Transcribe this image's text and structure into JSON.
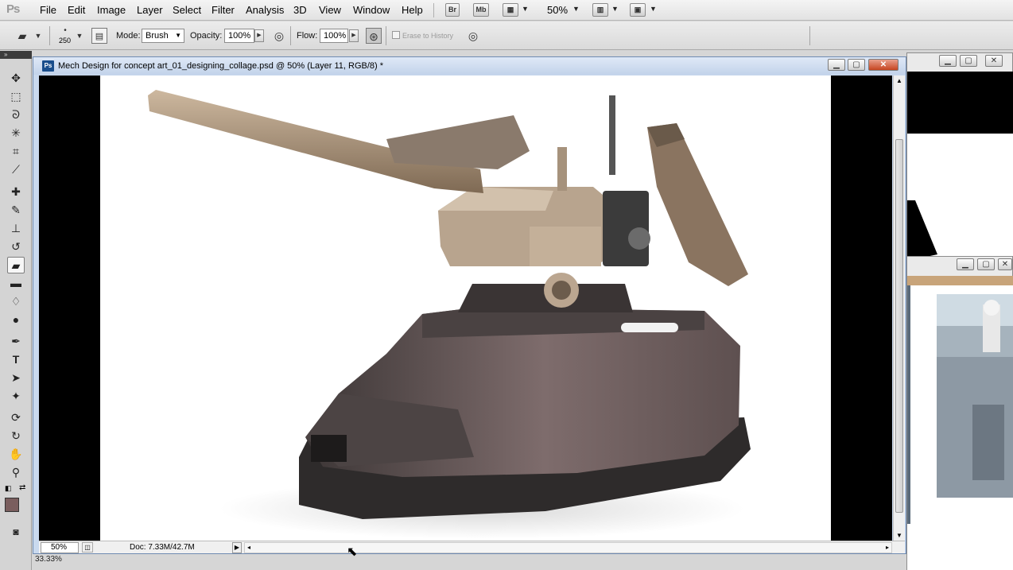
{
  "app": {
    "logo": "Ps"
  },
  "menu": [
    "File",
    "Edit",
    "Image",
    "Layer",
    "Select",
    "Filter",
    "Analysis",
    "3D",
    "View",
    "Window",
    "Help"
  ],
  "menubar_buttons": {
    "bridge": "Br",
    "minibridge": "Mb",
    "zoom": "50%"
  },
  "options": {
    "brush_size": "250",
    "mode_label": "Mode:",
    "mode_value": "Brush",
    "opacity_label": "Opacity:",
    "opacity_value": "100%",
    "flow_label": "Flow:",
    "flow_value": "100%",
    "erase_history_label": "Erase to History"
  },
  "document": {
    "title": "Mech Design for concept art_01_designing_collage.psd @ 50% (Layer 11, RGB/8) *",
    "icon": "Ps",
    "zoom": "50%",
    "doc_size": "Doc: 7.33M/42.7M"
  },
  "bottom_zoom": "33.33%",
  "colors": {
    "foreground": "#7a5e5e",
    "background": "#ffffff",
    "titlebar": "#c2d3ea",
    "close": "#c64420"
  },
  "icons": {
    "eraser": "eraser-icon",
    "move": "move-icon",
    "marquee": "marquee-icon",
    "lasso": "lasso-icon",
    "magic-wand": "magic-wand-icon",
    "crop": "crop-icon",
    "eyedropper": "eyedropper-icon",
    "healing": "healing-brush-icon",
    "brush": "brush-icon",
    "stamp": "clone-stamp-icon",
    "history-brush": "history-brush-icon",
    "gradient": "gradient-icon",
    "blur": "blur-icon",
    "dodge": "dodge-icon",
    "pen": "pen-icon",
    "type": "type-icon",
    "path-select": "path-selection-icon",
    "shape": "shape-icon",
    "3d-rotate": "3d-rotate-icon",
    "3d-orbit": "3d-orbit-icon",
    "hand": "hand-icon",
    "zoom": "zoom-icon"
  }
}
